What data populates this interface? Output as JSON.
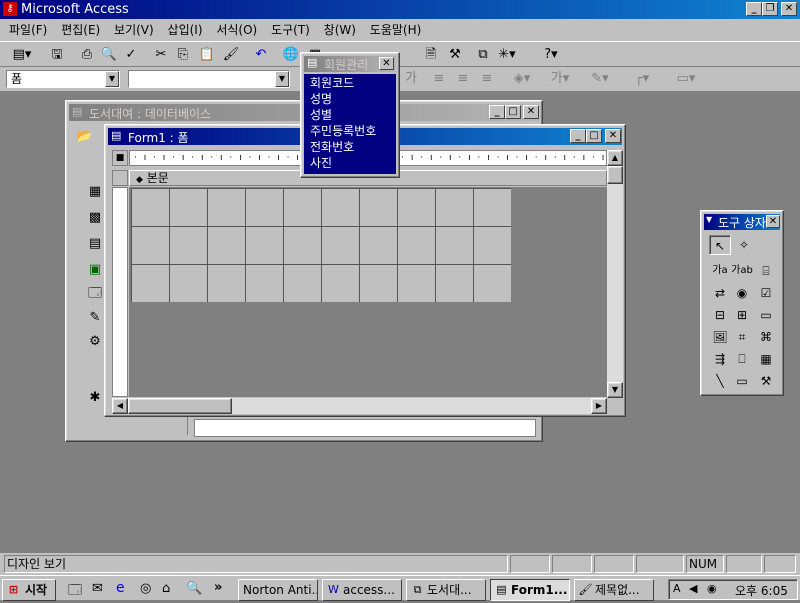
{
  "app": {
    "title": "Microsoft Access"
  },
  "menu": [
    "파일(F)",
    "편집(E)",
    "보기(V)",
    "삽입(I)",
    "서식(O)",
    "도구(T)",
    "창(W)",
    "도움말(H)"
  ],
  "format": {
    "object_combo": "폼",
    "font_combo": ""
  },
  "db_window": {
    "title": "도서대여 : 데이터베이스"
  },
  "form_window": {
    "title": "Form1 : 폼",
    "section": "본문"
  },
  "field_list": {
    "title": "회원관리",
    "fields": [
      "회원코드",
      "성명",
      "성별",
      "주민등록번호",
      "전화번호",
      "사진"
    ]
  },
  "toolbox": {
    "title": "도구 상자"
  },
  "statusbar": {
    "text": "디자인 보기",
    "num": "NUM"
  },
  "taskbar": {
    "start": "시작",
    "buttons": [
      "Norton Anti...",
      "access...",
      "도서대...",
      "Form1...",
      "제목없..."
    ],
    "clock": "오후 6:05"
  }
}
